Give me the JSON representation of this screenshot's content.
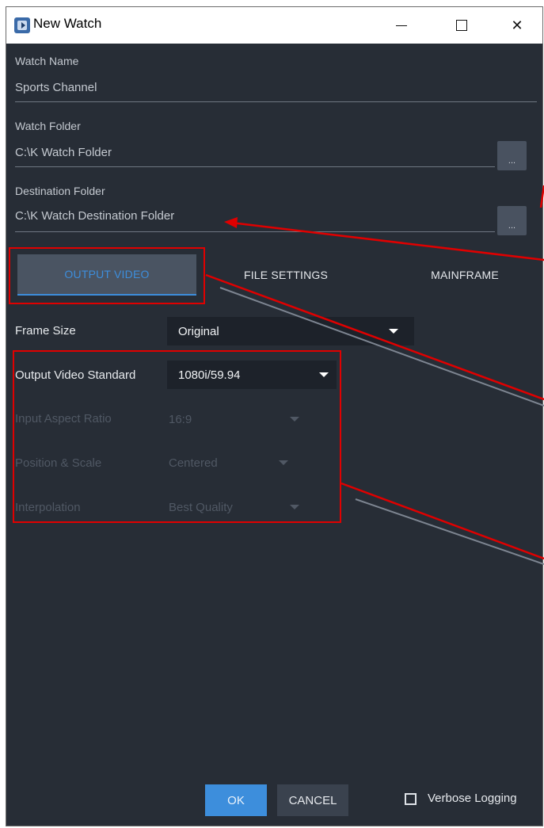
{
  "window": {
    "title": "New Watch"
  },
  "fields": {
    "watch_name": {
      "label": "Watch Name",
      "value": "Sports Channel"
    },
    "watch_folder": {
      "label": "Watch Folder",
      "value": "C:\\K Watch Folder",
      "browse_label": "..."
    },
    "destination_folder": {
      "label": "Destination Folder",
      "value": "C:\\K Watch Destination Folder",
      "browse_label": "..."
    }
  },
  "tabs": [
    {
      "label": "OUTPUT VIDEO",
      "active": true
    },
    {
      "label": "FILE SETTINGS",
      "active": false
    },
    {
      "label": "MAINFRAME",
      "active": false
    }
  ],
  "settings": {
    "frame_size": {
      "label": "Frame Size",
      "value": "Original",
      "enabled": true
    },
    "output_video_standard": {
      "label": "Output Video Standard",
      "value": "1080i/59.94",
      "enabled": true
    },
    "input_aspect_ratio": {
      "label": "Input Aspect Ratio",
      "value": "16:9",
      "enabled": false
    },
    "position_scale": {
      "label": "Position & Scale",
      "value": "Centered",
      "enabled": false
    },
    "interpolation": {
      "label": "Interpolation",
      "value": "Best Quality",
      "enabled": false
    }
  },
  "footer": {
    "ok_label": "OK",
    "cancel_label": "CANCEL",
    "verbose_label": "Verbose Logging",
    "verbose_checked": false
  },
  "colors": {
    "background": "#272d36",
    "accent": "#3d8edc",
    "annotation": "#e00000"
  }
}
